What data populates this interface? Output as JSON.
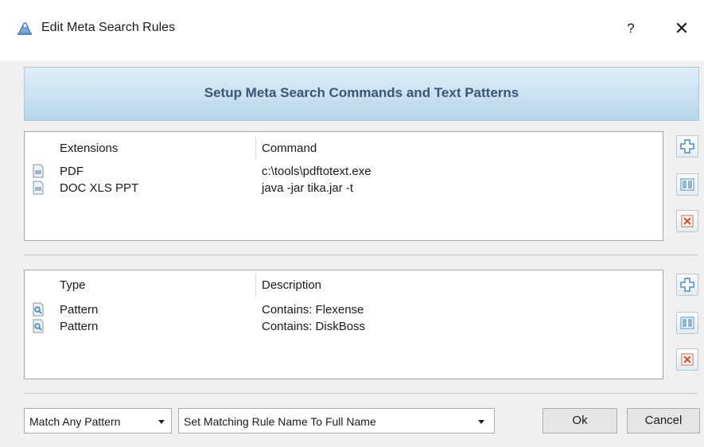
{
  "window": {
    "title": "Edit Meta Search Rules",
    "help_label": "?",
    "close_label": "✕",
    "app_icon": "app-icon"
  },
  "banner": {
    "text": "Setup Meta Search Commands and Text Patterns"
  },
  "commands_table": {
    "headers": {
      "col1": "Extensions",
      "col2": "Command"
    },
    "rows": [
      {
        "extensions": "PDF",
        "command": "c:\\tools\\pdftotext.exe",
        "icon": "document-icon"
      },
      {
        "extensions": "DOC XLS PPT",
        "command": "java -jar tika.jar -t",
        "icon": "document-icon"
      }
    ]
  },
  "patterns_table": {
    "headers": {
      "col1": "Type",
      "col2": "Description"
    },
    "rows": [
      {
        "type": "Pattern",
        "description": "Contains: Flexense",
        "icon": "pattern-search-icon"
      },
      {
        "type": "Pattern",
        "description": "Contains: DiskBoss",
        "icon": "pattern-search-icon"
      }
    ]
  },
  "side_buttons": {
    "add": "add-icon",
    "edit": "edit-icon",
    "delete": "delete-icon"
  },
  "footer": {
    "match_mode": "Match Any Pattern",
    "rule_name_mode": "Set Matching Rule Name To Full Name",
    "ok_label": "Ok",
    "cancel_label": "Cancel"
  },
  "colors": {
    "banner_text": "#3b5573",
    "banner_top": "#dfeef8",
    "banner_bottom": "#b8d6ea"
  }
}
